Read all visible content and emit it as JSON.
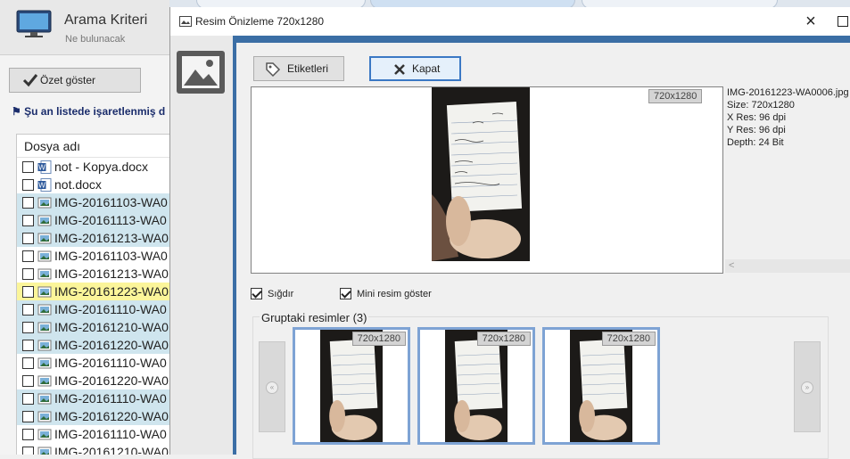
{
  "background_app": {
    "title": "Arama Kriteri",
    "subtitle": "Ne bulunacak",
    "summary_button": "Özet göster",
    "flag_text": "Şu an listede işaretlenmiş d",
    "file_list_header": "Dosya adı",
    "files": [
      {
        "name": "not - Kopya.docx",
        "type": "word",
        "state": "normal"
      },
      {
        "name": "not.docx",
        "type": "word",
        "state": "normal"
      },
      {
        "name": "IMG-20161103-WA0",
        "type": "image",
        "state": "highlight"
      },
      {
        "name": "IMG-20161113-WA0",
        "type": "image",
        "state": "highlight"
      },
      {
        "name": "IMG-20161213-WA0",
        "type": "image",
        "state": "highlight"
      },
      {
        "name": "IMG-20161103-WA0",
        "type": "image",
        "state": "normal"
      },
      {
        "name": "IMG-20161213-WA0",
        "type": "image",
        "state": "normal"
      },
      {
        "name": "IMG-20161223-WA0",
        "type": "image",
        "state": "selected"
      },
      {
        "name": "IMG-20161110-WA0",
        "type": "image",
        "state": "highlight"
      },
      {
        "name": "IMG-20161210-WA0",
        "type": "image",
        "state": "highlight"
      },
      {
        "name": "IMG-20161220-WA0",
        "type": "image",
        "state": "highlight"
      },
      {
        "name": "IMG-20161110-WA0",
        "type": "image",
        "state": "normal"
      },
      {
        "name": "IMG-20161220-WA0",
        "type": "image",
        "state": "normal"
      },
      {
        "name": "IMG-20161110-WA0",
        "type": "image",
        "state": "highlight"
      },
      {
        "name": "IMG-20161220-WA0",
        "type": "image",
        "state": "highlight"
      },
      {
        "name": "IMG-20161110-WA0",
        "type": "image",
        "state": "normal"
      },
      {
        "name": "IMG-20161210-WA0",
        "type": "image",
        "state": "normal"
      }
    ]
  },
  "dialog": {
    "title": "Resim Önizleme 720x1280",
    "buttons": {
      "tags": "Etiketleri",
      "close": "Kapat"
    },
    "preview_resolution": "720x1280",
    "info": {
      "filename": "IMG-20161223-WA0006.jpg",
      "size": "Size: 720x1280",
      "xres": "X Res: 96 dpi",
      "yres": "Y Res: 96 dpi",
      "depth": "Depth: 24 Bit"
    },
    "options": {
      "fit": {
        "label": "Sığdır",
        "checked": true
      },
      "thumbnails": {
        "label": "Mini resim göster",
        "checked": true
      }
    },
    "group_label": "Gruptaki resimler (3)",
    "thumbnails": [
      {
        "resolution": "720x1280"
      },
      {
        "resolution": "720x1280"
      },
      {
        "resolution": "720x1280"
      }
    ]
  },
  "colors": {
    "accent": "#3b6ea5",
    "highlight_row": "#cfe5ee",
    "selected_row": "#fbf59a",
    "thumb_border": "#7ea3d4"
  }
}
